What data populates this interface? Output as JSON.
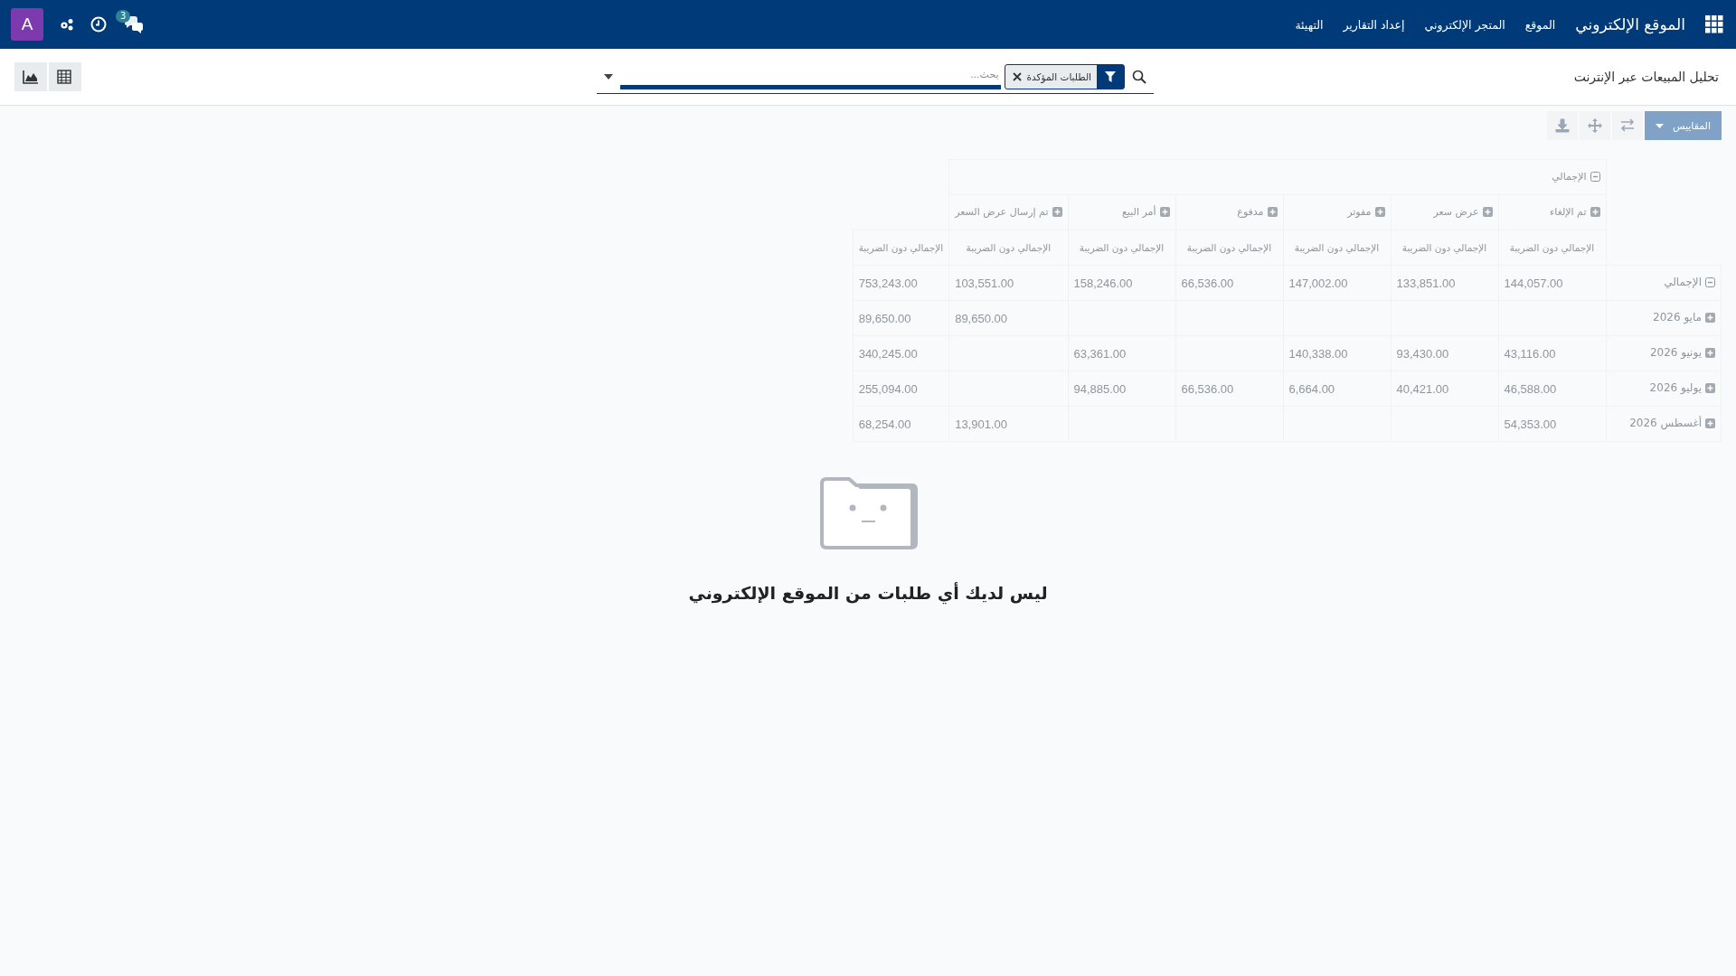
{
  "navbar": {
    "app_title": "الموقع الإلكتروني",
    "menu": [
      "الموقع",
      "المتجر الإلكتروني",
      "إعداد التقارير",
      "التهيئة"
    ],
    "messages_count": "3",
    "avatar": "A"
  },
  "control_panel": {
    "title": "تحليل المبيعات عبر الإنترنت",
    "search": {
      "facets": [
        {
          "kind": "filter",
          "label": "الطلبات المؤكدة"
        }
      ],
      "placeholder": "بحث..."
    },
    "views": [
      {
        "kind": "graph"
      },
      {
        "kind": "pivot"
      }
    ]
  },
  "toolbar": {
    "measures_button": "المقاييس"
  },
  "pivot": {
    "header_total": {
      "label": "الإجمالي",
      "expanded": true
    },
    "columns": [
      {
        "label": "تم الإلغاء",
        "expanded": false
      },
      {
        "label": "عرض سعر",
        "expanded": false
      },
      {
        "label": "مفوتر",
        "expanded": false
      },
      {
        "label": "مدفوع",
        "expanded": false
      },
      {
        "label": "أمر البيع",
        "expanded": false
      },
      {
        "label": "تم إرسال عرض السعر",
        "expanded": false
      }
    ],
    "measures": [
      "الإجمالي دون الضريبة",
      "الإجمالي دون الضريبة",
      "الإجمالي دون الضريبة",
      "الإجمالي دون الضريبة",
      "الإجمالي دون الضريبة",
      "الإجمالي دون الضريبة",
      "الإجمالي دون الضريبة"
    ],
    "rows": [
      {
        "label": "الإجمالي",
        "expanded": true,
        "cells": [
          "144,057.00",
          "133,851.00",
          "147,002.00",
          "66,536.00",
          "158,246.00",
          "103,551.00",
          "753,243.00"
        ]
      },
      {
        "label": "مايو 2026",
        "expanded": false,
        "cells": [
          null,
          null,
          null,
          null,
          null,
          "89,650.00",
          "89,650.00"
        ]
      },
      {
        "label": "يونيو 2026",
        "expanded": false,
        "cells": [
          "43,116.00",
          "93,430.00",
          "140,338.00",
          null,
          "63,361.00",
          null,
          "340,245.00"
        ]
      },
      {
        "label": "يوليو 2026",
        "expanded": false,
        "cells": [
          "46,588.00",
          "40,421.00",
          "6,664.00",
          "66,536.00",
          "94,885.00",
          null,
          "255,094.00"
        ]
      },
      {
        "label": "أغسطس 2026",
        "expanded": false,
        "cells": [
          "54,353.00",
          null,
          null,
          null,
          null,
          "13,901.00",
          "68,254.00"
        ]
      }
    ]
  },
  "empty_state": {
    "message": "ليس لديك أي طلبات من الموقع الإلكتروني"
  }
}
